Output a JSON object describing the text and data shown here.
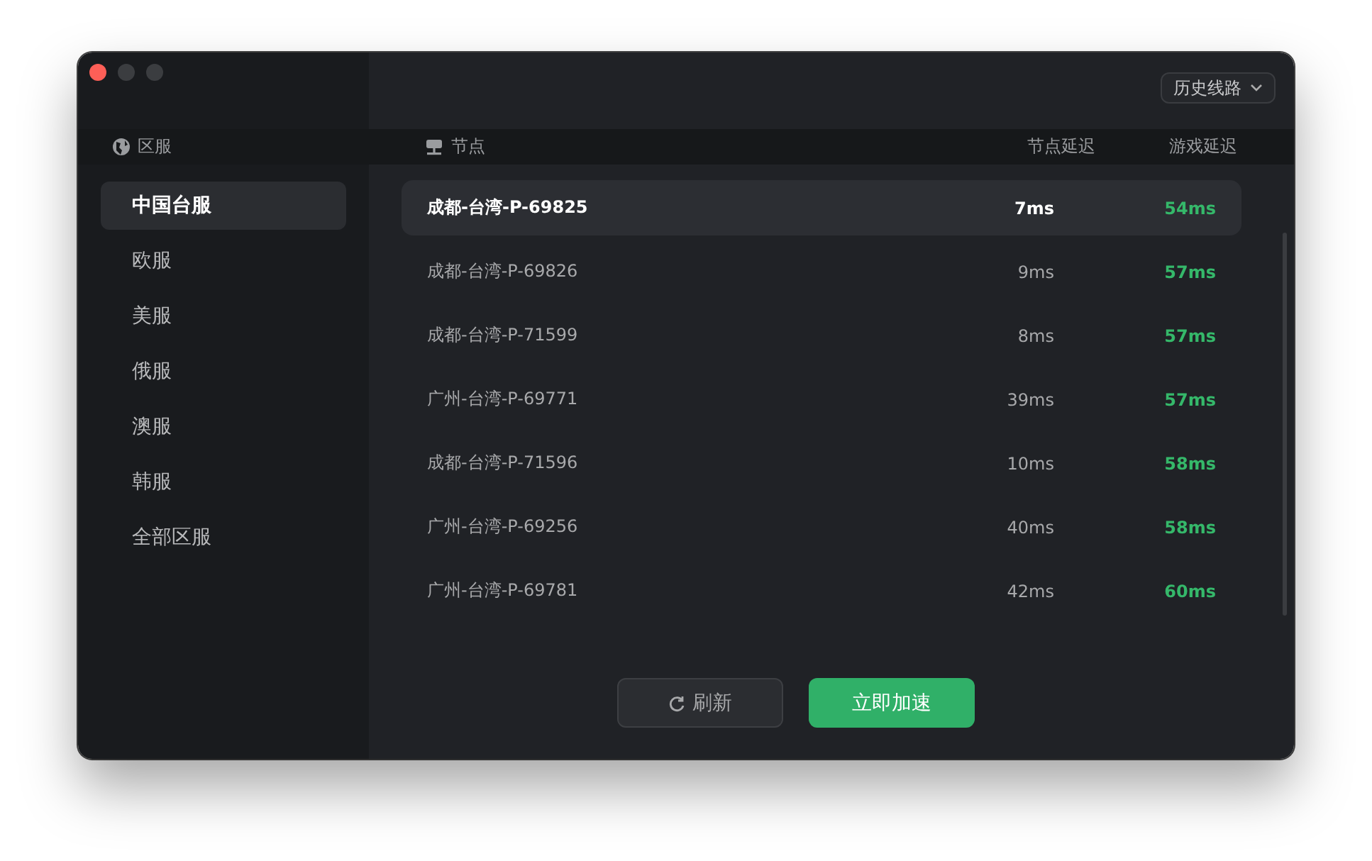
{
  "history_dropdown": {
    "label": "历史线路"
  },
  "regions": {
    "header": "区服",
    "items": [
      {
        "label": "中国台服",
        "selected": true
      },
      {
        "label": "欧服",
        "selected": false
      },
      {
        "label": "美服",
        "selected": false
      },
      {
        "label": "俄服",
        "selected": false
      },
      {
        "label": "澳服",
        "selected": false
      },
      {
        "label": "韩服",
        "selected": false
      },
      {
        "label": "全部区服",
        "selected": false
      }
    ]
  },
  "nodes": {
    "columns": [
      "节点",
      "节点延迟",
      "游戏延迟"
    ],
    "rows": [
      {
        "node": "成都-台湾-P-69825",
        "node_latency": "7ms",
        "game_latency": "54ms",
        "selected": true
      },
      {
        "node": "成都-台湾-P-69826",
        "node_latency": "9ms",
        "game_latency": "57ms",
        "selected": false
      },
      {
        "node": "成都-台湾-P-71599",
        "node_latency": "8ms",
        "game_latency": "57ms",
        "selected": false
      },
      {
        "node": "广州-台湾-P-69771",
        "node_latency": "39ms",
        "game_latency": "57ms",
        "selected": false
      },
      {
        "node": "成都-台湾-P-71596",
        "node_latency": "10ms",
        "game_latency": "58ms",
        "selected": false
      },
      {
        "node": "广州-台湾-P-69256",
        "node_latency": "40ms",
        "game_latency": "58ms",
        "selected": false
      },
      {
        "node": "广州-台湾-P-69781",
        "node_latency": "42ms",
        "game_latency": "60ms",
        "selected": false
      }
    ]
  },
  "buttons": {
    "refresh": "刷新",
    "accelerate": "立即加速"
  }
}
